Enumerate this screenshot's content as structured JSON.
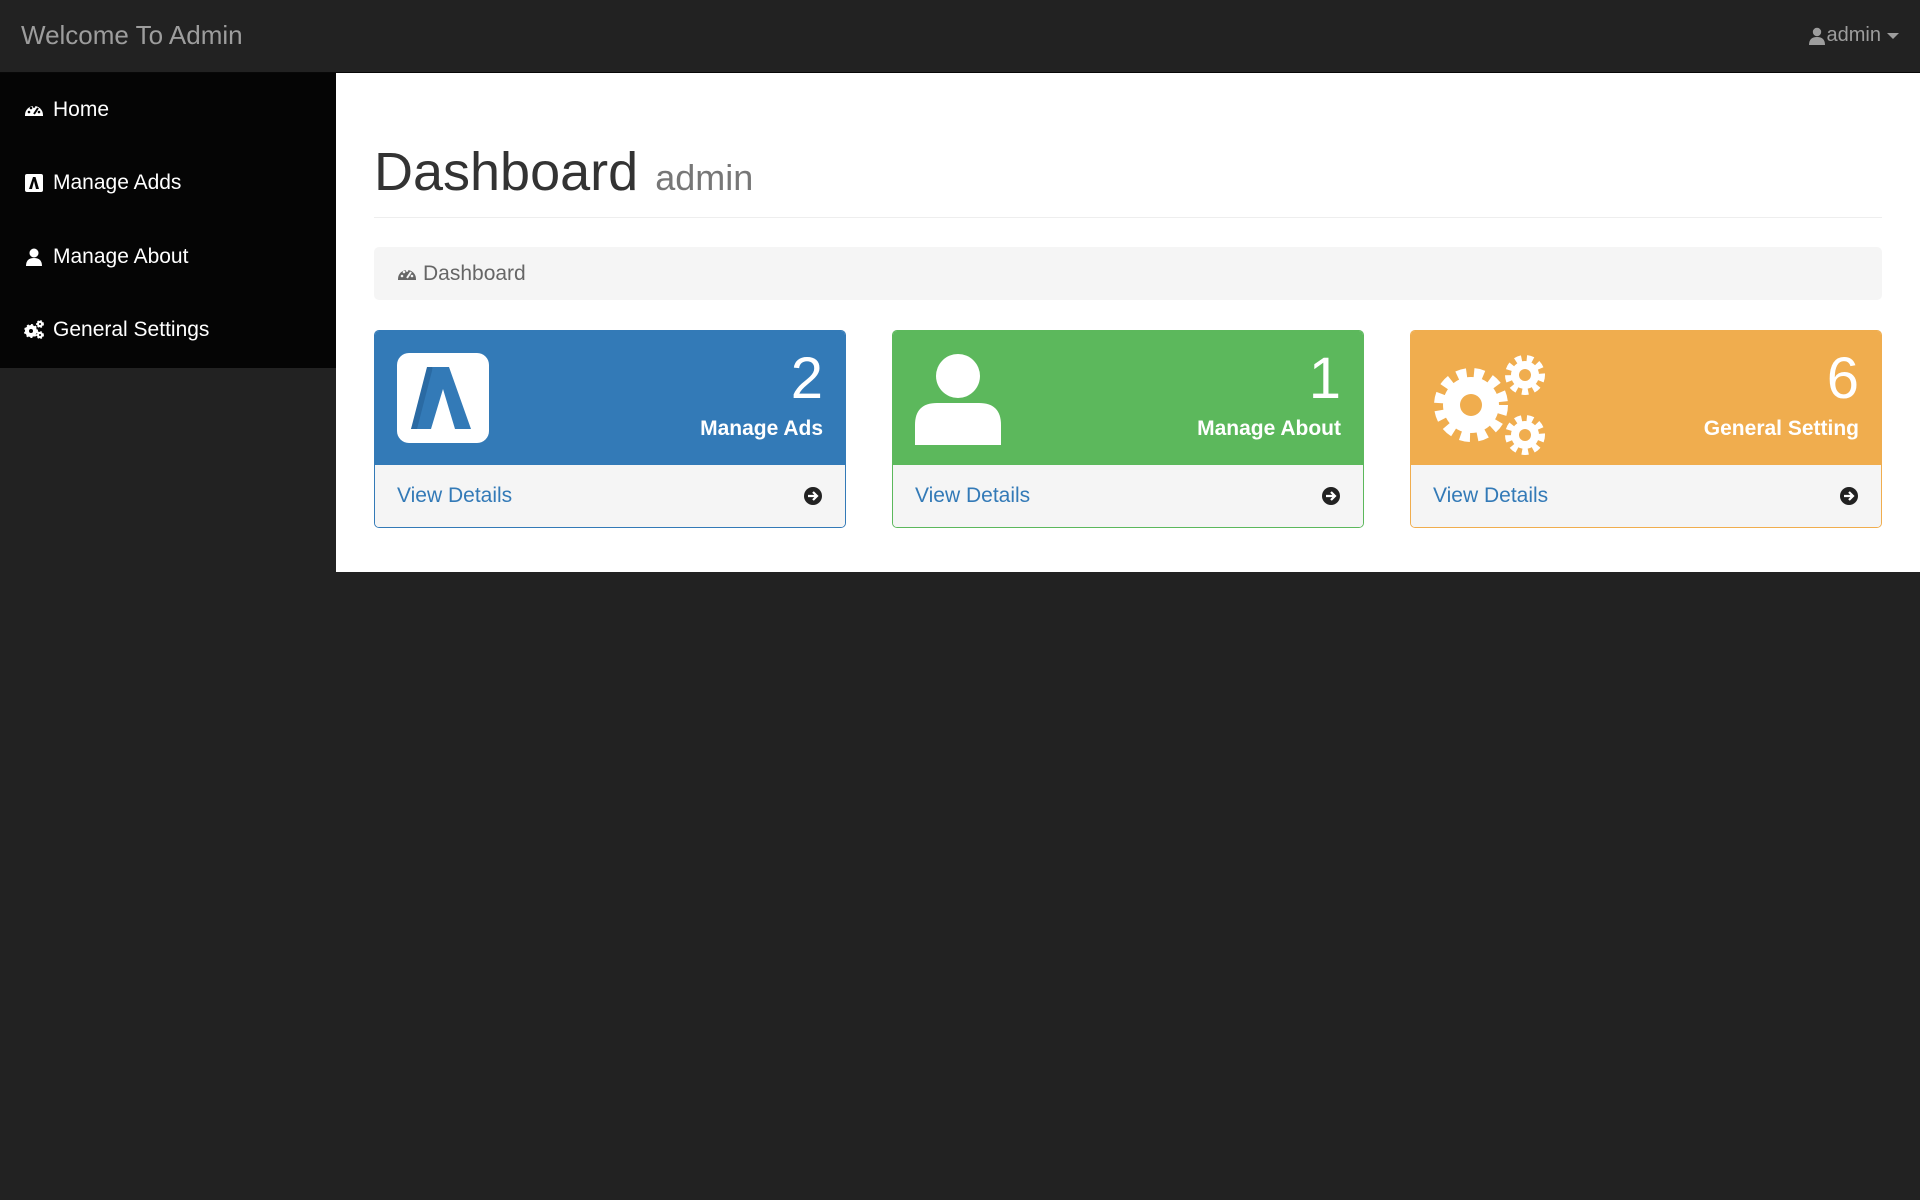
{
  "header": {
    "brand": "Welcome To Admin",
    "user": "admin"
  },
  "sidebar": {
    "items": [
      {
        "label": "Home",
        "icon": "dashboard-icon"
      },
      {
        "label": "Manage Adds",
        "icon": "ads-icon"
      },
      {
        "label": "Manage About",
        "icon": "user-icon"
      },
      {
        "label": "General Settings",
        "icon": "gears-icon"
      }
    ]
  },
  "main": {
    "title": "Dashboard",
    "subtitle": "admin",
    "breadcrumb": "Dashboard",
    "cards": [
      {
        "count": "2",
        "label": "Manage Ads",
        "link": "View Details",
        "icon": "ads-icon",
        "color": "#337ab7"
      },
      {
        "count": "1",
        "label": "Manage About",
        "link": "View Details",
        "icon": "user-icon",
        "color": "#5cb85c"
      },
      {
        "count": "6",
        "label": "General Setting",
        "link": "View Details",
        "icon": "gears-icon",
        "color": "#f0ad4e"
      }
    ]
  }
}
